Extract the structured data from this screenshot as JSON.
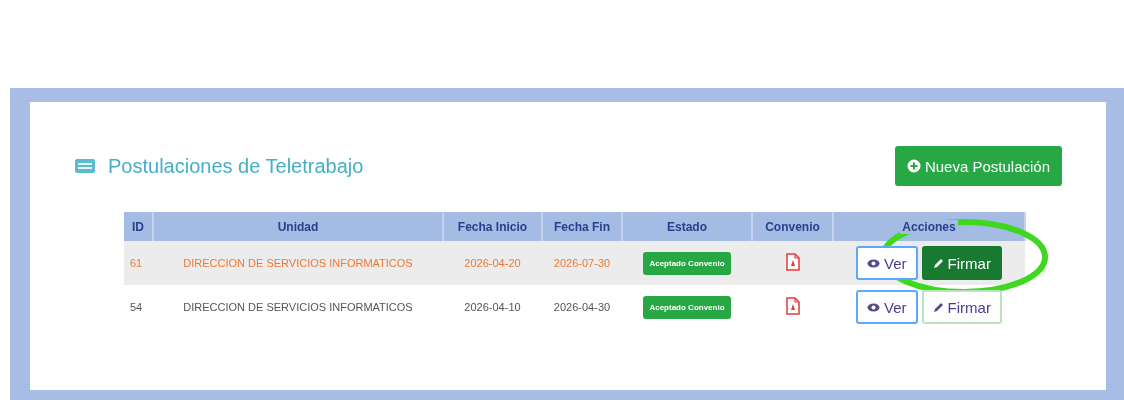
{
  "title": "Postulaciones de Teletrabajo",
  "new_button": "Nueva Postulación",
  "table": {
    "columns": [
      "ID",
      "Unidad",
      "Fecha Inicio",
      "Fecha Fin",
      "Estado",
      "Convenio",
      "Acciones"
    ],
    "rows": [
      {
        "id": "61",
        "unidad": "DIRECCION DE SERVICIOS INFORMATICOS",
        "fecha_inicio": "2026-04-20",
        "fecha_fin": "2026-07-30",
        "estado": "Aceptado Convenio",
        "ver": "Ver",
        "firmar": "Firmar",
        "selected": true
      },
      {
        "id": "54",
        "unidad": "DIRECCION DE SERVICIOS INFORMATICOS",
        "fecha_inicio": "2026-04-10",
        "fecha_fin": "2026-04-30",
        "estado": "Aceptado Convenio",
        "ver": "Ver",
        "firmar": "Firmar",
        "selected": false
      }
    ]
  }
}
